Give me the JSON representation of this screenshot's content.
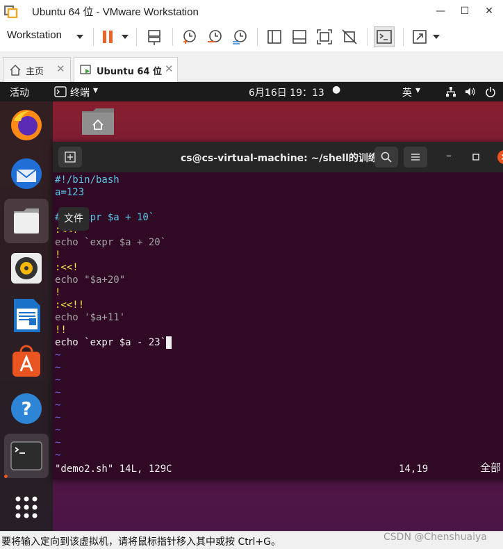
{
  "window": {
    "title": "Ubuntu 64 位 - VMware Workstation",
    "icons": [
      "vmware-app-icon",
      "minimize-icon",
      "maximize-icon",
      "close-icon"
    ],
    "controls": {
      "minimize": "—",
      "maximize": "☐",
      "close": "✕"
    }
  },
  "toolbar": {
    "menu_label": "Workstation",
    "buttons": [
      "pause-icon",
      "send-ctrl-alt-del-icon",
      "snapshot-icon",
      "revert-snapshot-icon",
      "snapshot-manager-icon",
      "sidebar-icon",
      "single-window-icon",
      "fullscreen-fit-icon",
      "unity-icon",
      "console-view-icon",
      "stretch-icon"
    ],
    "accent": "#e8642c"
  },
  "tabs": [
    {
      "label": "主页",
      "icon": "home-icon",
      "active": false
    },
    {
      "label": "Ubuntu 64 位",
      "icon": "vm-running-icon",
      "active": true
    }
  ],
  "gnome": {
    "activities": "活动",
    "app_menu": "终端",
    "clock": "6月16日  19：13",
    "input_method": "英",
    "status_icons": [
      "network-icon",
      "volume-icon",
      "power-icon"
    ]
  },
  "dock": {
    "items": [
      {
        "name": "firefox-icon"
      },
      {
        "name": "thunderbird-icon"
      },
      {
        "name": "files-icon"
      },
      {
        "name": "rhythmbox-icon"
      },
      {
        "name": "libreoffice-writer-icon"
      },
      {
        "name": "software-center-icon"
      },
      {
        "name": "help-icon"
      },
      {
        "name": "terminal-icon"
      },
      {
        "name": "show-apps-icon"
      }
    ],
    "tooltip": "文件"
  },
  "terminal": {
    "title": "cs@cs-virtual-machine: ~/shell的训练",
    "lines": [
      "#!/bin/bash",
      "a=123",
      "#  `expr $a + 10`",
      ":<<!",
      "echo `expr $a + 20`",
      "!",
      ":<<!",
      "echo \"$a+20\"",
      "!",
      ":<<!!",
      "echo '$a+11'",
      "!!",
      "echo `expr $a - 23`"
    ],
    "tilde": "~",
    "status_file": "\"demo2.sh\" 14L, 129C",
    "status_pos": "14,19",
    "status_all": "全部",
    "colors": {
      "bg": "#300a24",
      "comment": "#58c7e6",
      "marker": "#f3ea48",
      "tilde": "#6f6af0"
    }
  },
  "statusbar": {
    "message": "要将输入定向到该虚拟机，请将鼠标指针移入其中或按 Ctrl+G。",
    "watermark": "CSDN @Chenshuaiya"
  }
}
